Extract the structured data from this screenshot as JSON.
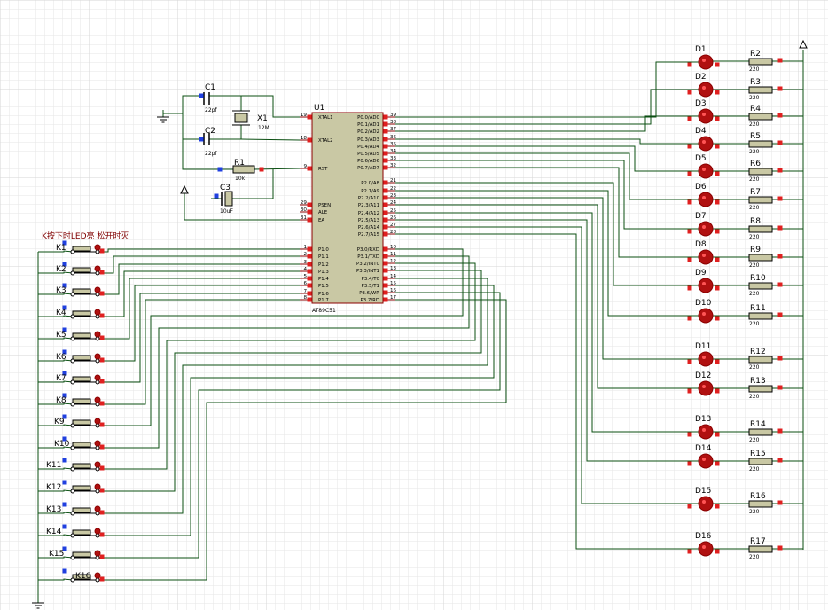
{
  "schematic": {
    "title_note": "K按下时LED亮 松开时灭",
    "mcu": {
      "ref": "U1",
      "part": "AT89C51",
      "left_pins": [
        {
          "num": "19",
          "name": "XTAL1"
        },
        {
          "num": "18",
          "name": "XTAL2"
        },
        {
          "num": "9",
          "name": "RST"
        },
        {
          "num": "29",
          "name": "PSEN"
        },
        {
          "num": "30",
          "name": "ALE"
        },
        {
          "num": "31",
          "name": "EA"
        },
        {
          "num": "1",
          "name": "P1.0"
        },
        {
          "num": "2",
          "name": "P1.1"
        },
        {
          "num": "3",
          "name": "P1.2"
        },
        {
          "num": "4",
          "name": "P1.3"
        },
        {
          "num": "5",
          "name": "P1.4"
        },
        {
          "num": "6",
          "name": "P1.5"
        },
        {
          "num": "7",
          "name": "P1.6"
        },
        {
          "num": "8",
          "name": "P1.7"
        }
      ],
      "right_pins": [
        {
          "num": "39",
          "name": "P0.0/AD0"
        },
        {
          "num": "38",
          "name": "P0.1/AD1"
        },
        {
          "num": "37",
          "name": "P0.2/AD2"
        },
        {
          "num": "36",
          "name": "P0.3/AD3"
        },
        {
          "num": "35",
          "name": "P0.4/AD4"
        },
        {
          "num": "34",
          "name": "P0.5/AD5"
        },
        {
          "num": "33",
          "name": "P0.6/AD6"
        },
        {
          "num": "32",
          "name": "P0.7/AD7"
        },
        {
          "num": "21",
          "name": "P2.0/A8"
        },
        {
          "num": "22",
          "name": "P2.1/A9"
        },
        {
          "num": "23",
          "name": "P2.2/A10"
        },
        {
          "num": "24",
          "name": "P2.3/A11"
        },
        {
          "num": "25",
          "name": "P2.4/A12"
        },
        {
          "num": "26",
          "name": "P2.5/A13"
        },
        {
          "num": "27",
          "name": "P2.6/A14"
        },
        {
          "num": "28",
          "name": "P2.7/A15"
        },
        {
          "num": "10",
          "name": "P3.0/RXD"
        },
        {
          "num": "11",
          "name": "P3.1/TXD"
        },
        {
          "num": "12",
          "name": "P3.2/INT0"
        },
        {
          "num": "13",
          "name": "P3.3/INT1"
        },
        {
          "num": "14",
          "name": "P3.4/T0"
        },
        {
          "num": "15",
          "name": "P3.5/T1"
        },
        {
          "num": "16",
          "name": "P3.6/WR"
        },
        {
          "num": "17",
          "name": "P3.7/RD"
        }
      ]
    },
    "passives": [
      {
        "ref": "C1",
        "value": "22pf"
      },
      {
        "ref": "C2",
        "value": "22pf"
      },
      {
        "ref": "X1",
        "value": "12M"
      },
      {
        "ref": "R1",
        "value": "10k"
      },
      {
        "ref": "C3",
        "value": "10uF"
      }
    ],
    "switches": [
      "K1",
      "K2",
      "K3",
      "K4",
      "K5",
      "K6",
      "K7",
      "K8",
      "K9",
      "K10",
      "K11",
      "K12",
      "K13",
      "K14",
      "K15",
      "K16"
    ],
    "leds": [
      "D1",
      "D2",
      "D3",
      "D4",
      "D5",
      "D6",
      "D7",
      "D8",
      "D9",
      "D10",
      "D11",
      "D12",
      "D13",
      "D14",
      "D15",
      "D16"
    ],
    "resistors": [
      {
        "ref": "R2",
        "value": "220"
      },
      {
        "ref": "R3",
        "value": "220"
      },
      {
        "ref": "R4",
        "value": "220"
      },
      {
        "ref": "R5",
        "value": "220"
      },
      {
        "ref": "R6",
        "value": "220"
      },
      {
        "ref": "R7",
        "value": "220"
      },
      {
        "ref": "R8",
        "value": "220"
      },
      {
        "ref": "R9",
        "value": "220"
      },
      {
        "ref": "R10",
        "value": "220"
      },
      {
        "ref": "R11",
        "value": "220"
      },
      {
        "ref": "R12",
        "value": "220"
      },
      {
        "ref": "R13",
        "value": "220"
      },
      {
        "ref": "R14",
        "value": "220"
      },
      {
        "ref": "R15",
        "value": "220"
      },
      {
        "ref": "R16",
        "value": "220"
      },
      {
        "ref": "R17",
        "value": "220"
      }
    ],
    "colors": {
      "wire": "#0b4f12",
      "component": "#8b0000",
      "chip_fill": "#c9c8a4",
      "led_fill": "#b01010",
      "resistor_fill": "#c9c8a4",
      "pin_marker_red": "#e02020",
      "pin_marker_blue": "#2040e0",
      "grid": "#e8e8e8"
    }
  }
}
